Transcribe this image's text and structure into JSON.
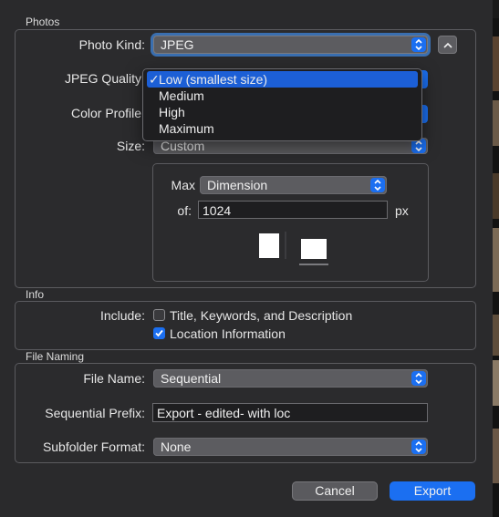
{
  "photos": {
    "section_title": "Photos",
    "photo_kind_label": "Photo Kind:",
    "photo_kind_value": "JPEG",
    "jpeg_quality_label": "JPEG Quality",
    "color_profile_label": "Color Profile",
    "size_label": "Size:",
    "size_value": "Custom",
    "max_label": "Max",
    "max_value": "Dimension",
    "of_label": "of:",
    "of_value": "1024",
    "px_label": "px"
  },
  "quality_menu": {
    "items": [
      {
        "label": "Low (smallest size)",
        "checked": true
      },
      {
        "label": "Medium",
        "checked": false
      },
      {
        "label": "High",
        "checked": false
      },
      {
        "label": "Maximum",
        "checked": false
      }
    ],
    "check_glyph": "✓"
  },
  "info": {
    "section_title": "Info",
    "include_label": "Include:",
    "title_keywords_label": "Title, Keywords, and Description",
    "title_keywords_checked": false,
    "location_label": "Location Information",
    "location_checked": true
  },
  "file_naming": {
    "section_title": "File Naming",
    "file_name_label": "File Name:",
    "file_name_value": "Sequential",
    "prefix_label": "Sequential Prefix:",
    "prefix_value": "Export - edited- with loc",
    "subfolder_label": "Subfolder Format:",
    "subfolder_value": "None"
  },
  "buttons": {
    "cancel": "Cancel",
    "export": "Export"
  },
  "colors": {
    "accent": "#1b6ff1",
    "background": "#2a2a2c"
  },
  "icons": [
    "chevron-up-icon",
    "updown-arrows-icon",
    "checkmark-icon",
    "portrait-orientation-icon",
    "landscape-orientation-icon"
  ]
}
